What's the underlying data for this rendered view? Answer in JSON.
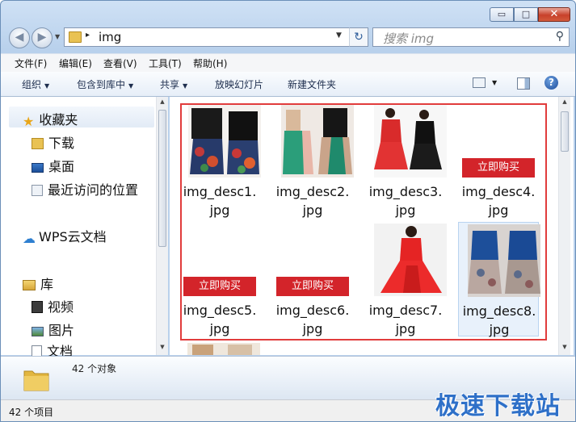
{
  "window": {
    "minimize_glyph": "▭",
    "maximize_glyph": "□",
    "close_glyph": "✕"
  },
  "address": {
    "path": "img",
    "refresh_glyph": "↻",
    "search_placeholder": "搜索 img"
  },
  "menu": [
    "文件(F)",
    "编辑(E)",
    "查看(V)",
    "工具(T)",
    "帮助(H)"
  ],
  "toolbar": {
    "organize": "组织",
    "include_library": "包含到库中",
    "share": "共享",
    "slideshow": "放映幻灯片",
    "new_folder": "新建文件夹",
    "help_glyph": "?"
  },
  "sidebar": {
    "favorites": "收藏夹",
    "downloads": "下载",
    "desktop": "桌面",
    "recent": "最近访问的位置",
    "wps": "WPS云文档",
    "library": "库",
    "videos": "视频",
    "pictures": "图片",
    "documents": "文档"
  },
  "files": [
    {
      "line1": "img_desc1.",
      "line2": "jpg"
    },
    {
      "line1": "img_desc2.",
      "line2": "jpg"
    },
    {
      "line1": "img_desc3.",
      "line2": "jpg"
    },
    {
      "line1": "img_desc4.",
      "line2": "jpg"
    },
    {
      "line1": "img_desc5.",
      "line2": "jpg"
    },
    {
      "line1": "img_desc6.",
      "line2": "jpg"
    },
    {
      "line1": "img_desc7.",
      "line2": "jpg"
    },
    {
      "line1": "img_desc8.",
      "line2": "jpg"
    }
  ],
  "buy_label": "立即购买",
  "details": {
    "count": "42 个对象"
  },
  "status": {
    "items": "42 个项目"
  },
  "watermark": "极速下载站",
  "colors": {
    "highlight_border": "#e13c3c",
    "buy_button": "#d3242a",
    "watermark": "#2e70c8"
  }
}
